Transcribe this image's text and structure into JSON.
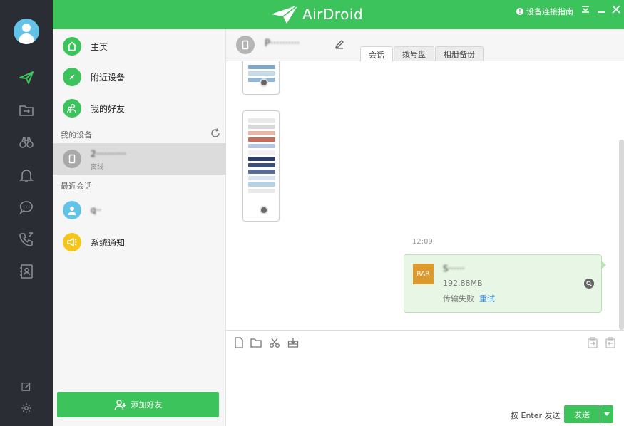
{
  "app": {
    "name": "AirDroid"
  },
  "topbar": {
    "guide_label": "设备连接指南"
  },
  "nav": {
    "items": [
      {
        "label": "主页",
        "icon": "home-icon"
      },
      {
        "label": "附近设备",
        "icon": "compass-icon"
      },
      {
        "label": "我的好友",
        "icon": "friends-icon"
      }
    ],
    "my_devices_title": "我的设备",
    "device": {
      "name": "2···········",
      "status": "离线"
    },
    "recent_title": "最近会话",
    "recent": [
      {
        "label": "q··"
      },
      {
        "label": "系统通知"
      }
    ],
    "add_friend_label": "添加好友"
  },
  "chat": {
    "device_name": "P··········",
    "tabs": [
      "会话",
      "拨号盘",
      "相册备份"
    ],
    "timestamp": "12:09",
    "file": {
      "type_badge": "RAR",
      "name": "S······",
      "size": "192.88MB",
      "status": "传输失败",
      "retry_label": "重试"
    }
  },
  "input": {
    "hint": "按 Enter 发送",
    "send_label": "发送"
  },
  "colors": {
    "accent": "#3dc35b",
    "rail": "#2a2d33",
    "avatar": "#62c2e8",
    "notify": "#f5c518",
    "rar": "#dc9a2d",
    "link": "#3a8fe8"
  }
}
